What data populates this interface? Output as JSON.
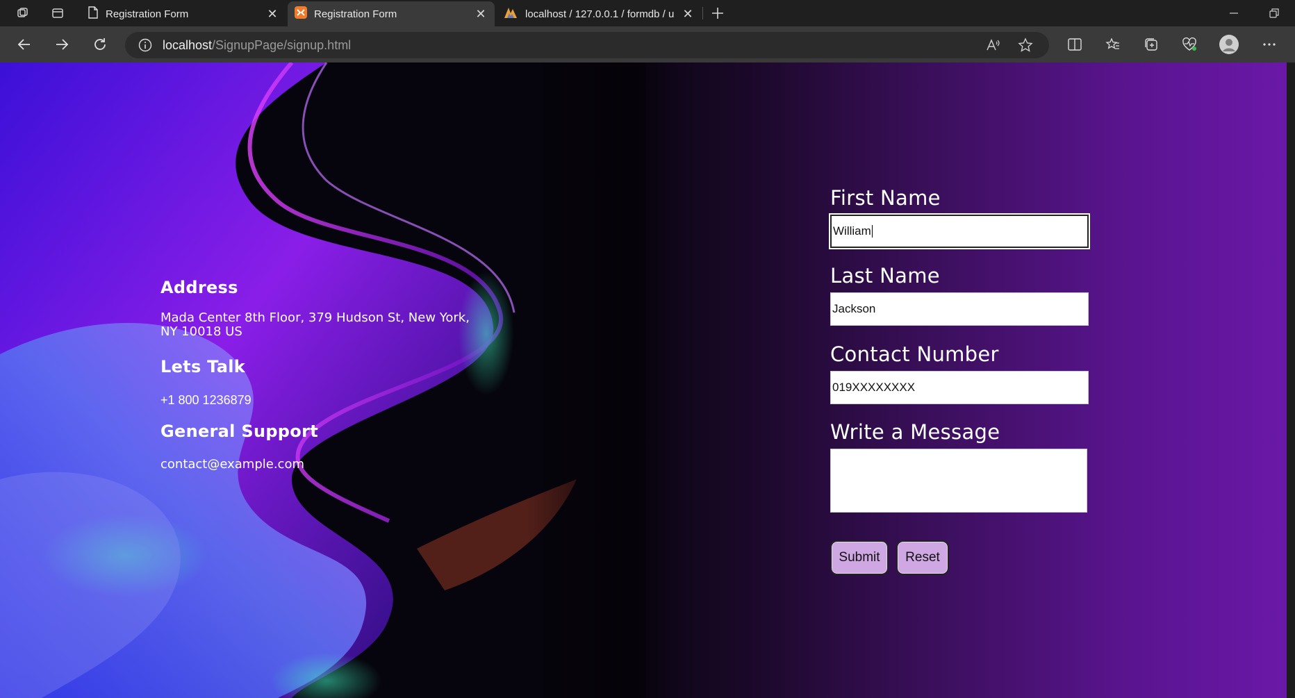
{
  "browser": {
    "tabs": [
      {
        "title": "Registration Form",
        "icon": "page-icon",
        "active": false
      },
      {
        "title": "Registration Form",
        "icon": "xampp-icon",
        "active": true
      },
      {
        "title": "localhost / 127.0.0.1 / formdb / u",
        "icon": "phpmyadmin-icon",
        "active": false
      }
    ],
    "url_host": "localhost",
    "url_path": "/SignupPage/signup.html"
  },
  "contact": {
    "address_heading": "Address",
    "address_line1": "Mada Center 8th Floor, 379 Hudson St, New York,",
    "address_line2": "NY 10018 US",
    "talk_heading": "Lets Talk",
    "phone": "+1 800 1236879",
    "support_heading": "General Support",
    "email": "contact@example.com"
  },
  "form": {
    "first_name_label": "First Name",
    "first_name_value": "William",
    "last_name_label": "Last Name",
    "last_name_value": "Jackson",
    "contact_label": "Contact Number",
    "contact_value": "019XXXXXXXX",
    "message_label": "Write a Message",
    "message_value": "",
    "submit_label": "Submit",
    "reset_label": "Reset"
  },
  "colors": {
    "button_bg": "#cfa7e3",
    "page_accent": "#6a18a8"
  }
}
